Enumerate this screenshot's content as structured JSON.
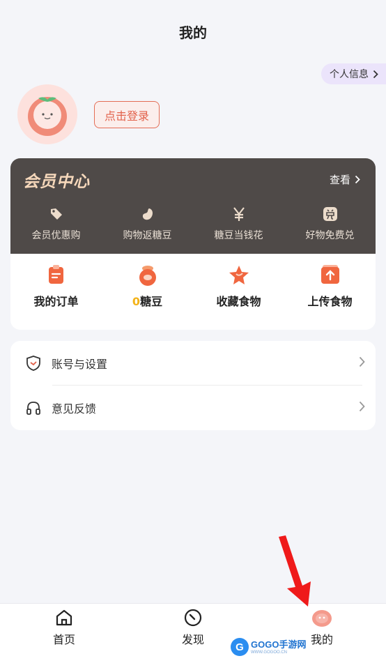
{
  "header": {
    "title": "我的"
  },
  "profile": {
    "info_label": "个人信息",
    "login_label": "点击登录"
  },
  "vip": {
    "title": "会员中心",
    "view_label": "查看",
    "perks": [
      {
        "label": "会员优惠购",
        "icon": "tag-icon"
      },
      {
        "label": "购物返糖豆",
        "icon": "bean-icon"
      },
      {
        "label": "糖豆当钱花",
        "icon": "yen-icon"
      },
      {
        "label": "好物免费兑",
        "icon": "redeem-icon"
      }
    ]
  },
  "quick": {
    "orders_label": "我的订单",
    "beans_count": "0",
    "beans_label": "糖豆",
    "favorites_label": "收藏食物",
    "upload_label": "上传食物"
  },
  "settings": {
    "items": [
      {
        "label": "账号与设置",
        "icon": "shield-icon"
      },
      {
        "label": "意见反馈",
        "icon": "headset-icon"
      }
    ]
  },
  "tabbar": {
    "tabs": [
      {
        "label": "首页",
        "icon": "home-icon"
      },
      {
        "label": "发现",
        "icon": "compass-icon"
      },
      {
        "label": "我的",
        "icon": "tomato-icon"
      }
    ]
  },
  "watermark": {
    "main": "GOGO手游网",
    "sub": "WWW.GOGOO.CN"
  },
  "colors": {
    "accent": "#e2614a",
    "vip_bg": "#4f4a48",
    "vip_text": "#f6d8bb",
    "beans": "#f3b31a",
    "chip": "#ebe4fb"
  }
}
